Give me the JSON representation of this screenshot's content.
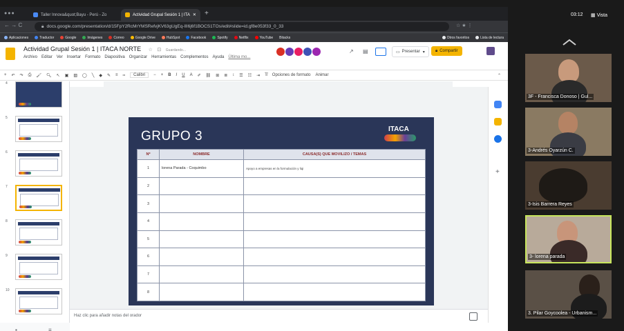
{
  "browser": {
    "tabs": [
      {
        "label": "Taller Innova&quot;Bayu - Perú - Zo"
      },
      {
        "label": "Actividad Grupal Sesión 1 | ITA"
      }
    ],
    "url": "docs.google.com/presentation/d/15FpY2RcMrYMSRefvjKV63gUgEq-lII6j6f1BOCS1TOs/edit#slide=id.gf8e053f33_0_33",
    "bookmarks": [
      "Aplicaciones",
      "Traductor",
      "Google",
      "Imágenes",
      "Correo",
      "Google Drive",
      "HubSpot",
      "Facebook",
      "Spotify",
      "Netflix",
      "YouTube",
      "Bitacks"
    ],
    "bookmarks_right": [
      "Otros favoritos",
      "Lista de lectura"
    ]
  },
  "docs": {
    "title": "Actividad Grupal Sesión 1 | ITACA NORTE",
    "saving": "Guardando...",
    "menus": [
      "Archivo",
      "Editar",
      "Ver",
      "Insertar",
      "Formato",
      "Diapositiva",
      "Organizar",
      "Herramientas",
      "Complementos",
      "Ayuda",
      "Última mo..."
    ],
    "present_label": "Presentar",
    "share_label": "Compartir",
    "toolbar": {
      "font": "Calibri",
      "format_options": "Opciones de formato",
      "animate": "Animar"
    },
    "notes_placeholder": "Haz clic para añadir notas del orador",
    "slide_numbers": [
      "4",
      "5",
      "6",
      "7",
      "8",
      "9",
      "10"
    ]
  },
  "slide": {
    "title": "GRUPO 3",
    "logo": "ITACA",
    "headers": [
      "Nº",
      "NOMBRE",
      "CAUSA(S) QUE MOVILIZO / TEMAS"
    ],
    "rows": [
      {
        "n": "1",
        "name": "lorena Parada - Coquimbo",
        "cause": "Apoyo a empresas en la formulación y liqi"
      },
      {
        "n": "2",
        "name": "",
        "cause": ""
      },
      {
        "n": "3",
        "name": "",
        "cause": ""
      },
      {
        "n": "4",
        "name": "",
        "cause": ""
      },
      {
        "n": "5",
        "name": "",
        "cause": ""
      },
      {
        "n": "6",
        "name": "",
        "cause": ""
      },
      {
        "n": "7",
        "name": "",
        "cause": ""
      },
      {
        "n": "8",
        "name": "",
        "cause": ""
      }
    ]
  },
  "zoom": {
    "time": "03:12",
    "view_label": "Vista",
    "participants": [
      {
        "name": "3F - Francisca Donoso | Gul..."
      },
      {
        "name": "3-Andrés Oyarzún C."
      },
      {
        "name": "3-Isis Barrera Reyes"
      },
      {
        "name": "3- lorena parada"
      },
      {
        "name": "3. Pilar Goycoolea - Urbanism..."
      }
    ]
  },
  "colors": {
    "slide_bg": "#2a3658",
    "accent": "#f4b400",
    "speaking": "#c8e65c"
  }
}
